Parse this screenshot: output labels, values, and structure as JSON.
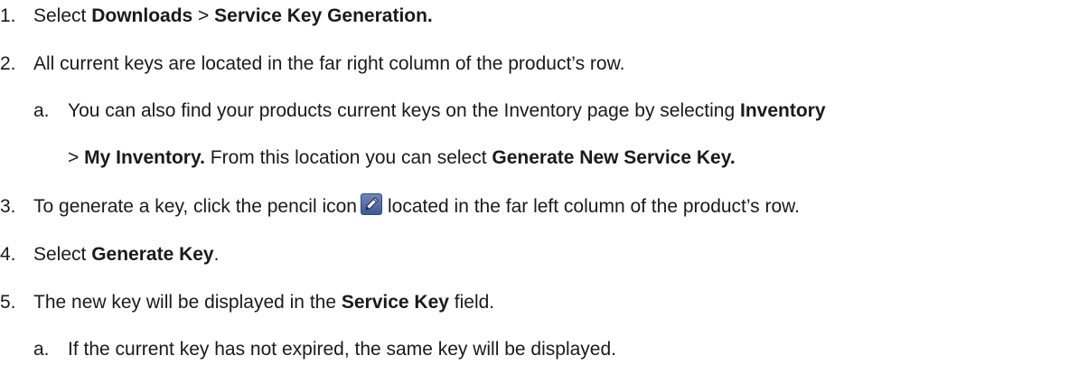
{
  "steps": {
    "s1": {
      "num": "1.",
      "t1": "Select ",
      "b1": "Downloads",
      "t2": " > ",
      "b2": "Service Key Generation."
    },
    "s2": {
      "num": "2.",
      "t1": "All current keys are located in the far right column of the product’s row."
    },
    "s2a": {
      "num": "a.",
      "t1": "You can also find your products current keys on the Inventory page by selecting ",
      "b1": "Inventory"
    },
    "s2a_cont": {
      "t1": "> ",
      "b1": "My Inventory.",
      "t2": " From this location you can select ",
      "b2": "Generate New Service Key."
    },
    "s3": {
      "num": "3.",
      "t1": "To generate a key, click the pencil icon",
      "icon": "pencil-edit-icon",
      "t2": "located in the far left column of the product’s row."
    },
    "s4": {
      "num": "4.",
      "t1": "Select ",
      "b1": "Generate Key",
      "t2": "."
    },
    "s5": {
      "num": "5.",
      "t1": "The new key will be displayed in the ",
      "b1": "Service Key",
      "t2": " field."
    },
    "s5a": {
      "num": "a.",
      "t1": "If the current key has not expired, the same key will be displayed."
    }
  }
}
